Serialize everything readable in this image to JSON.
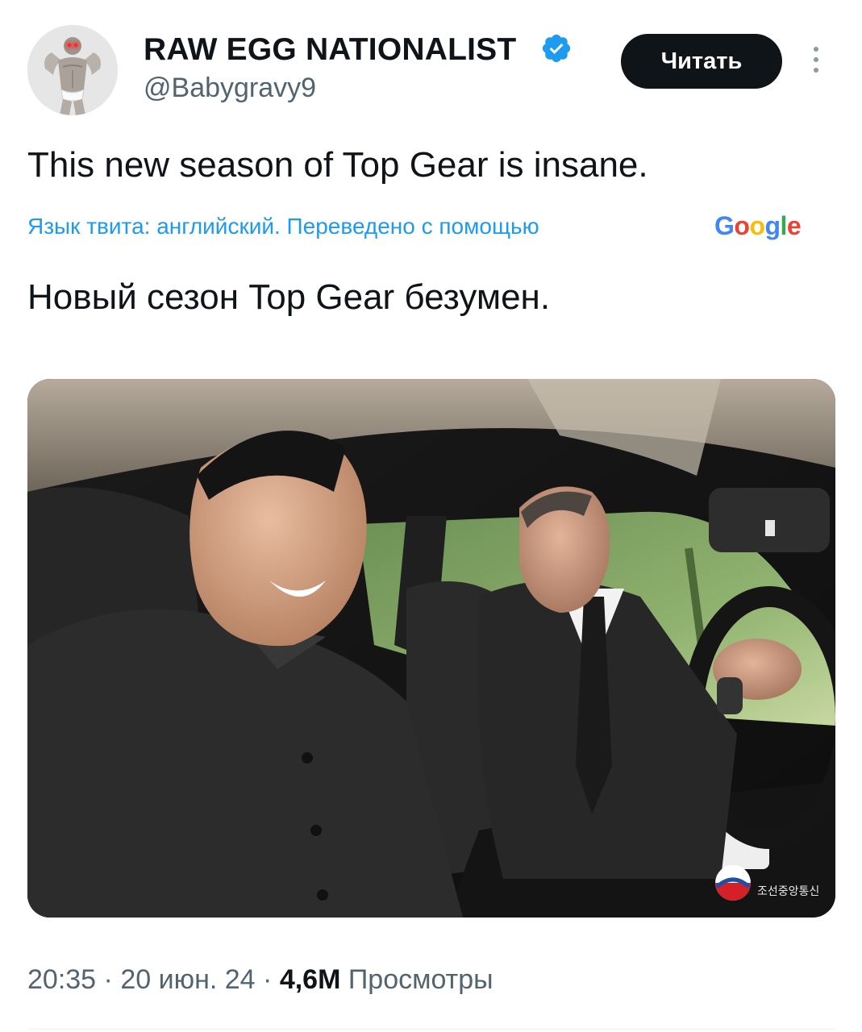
{
  "tweet": {
    "author": {
      "display_name": "RAW EGG NATIONALIST",
      "handle": "@Babygravy9",
      "verified": true,
      "verified_color": "#1d9bf0"
    },
    "follow_label": "Читать",
    "text": "This new season of Top Gear is insane.",
    "translation": {
      "label": "Язык твита: английский. Переведено с помощью",
      "provider_logo_text": "Google",
      "text": "Новый сезон Top Gear безумен."
    },
    "media": {
      "type": "photo",
      "watermark_text": "조선중앙통신"
    },
    "meta": {
      "time": "20:35",
      "separator": "·",
      "date": "20 июн. 24",
      "views_count": "4,6M",
      "views_label": "Просмотры"
    }
  },
  "colors": {
    "accent": "#1d9bf0",
    "text_primary": "#0f1419",
    "text_secondary": "#536471",
    "button_bg": "#0f1419"
  },
  "icons": {
    "verified": "verified-badge-icon",
    "more": "more-vertical-icon"
  }
}
